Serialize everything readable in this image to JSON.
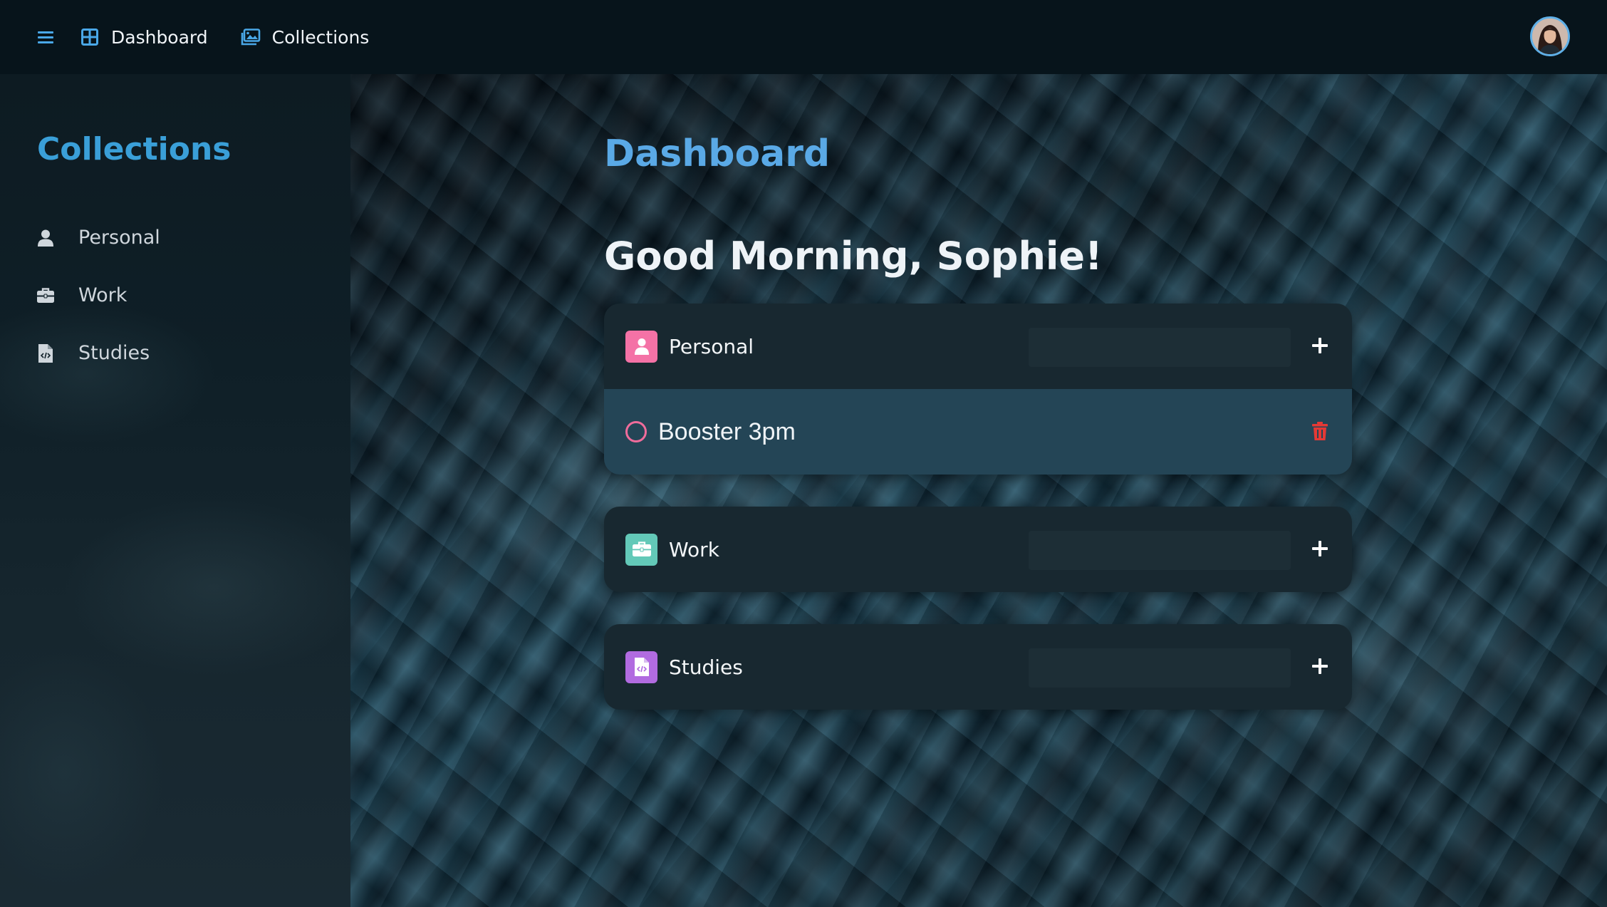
{
  "topbar": {
    "nav": [
      {
        "label": "Dashboard",
        "icon": "dashboard-grid-icon"
      },
      {
        "label": "Collections",
        "icon": "images-icon"
      }
    ],
    "avatar": "user-avatar"
  },
  "sidebar": {
    "title": "Collections",
    "items": [
      {
        "label": "Personal",
        "icon": "user-icon"
      },
      {
        "label": "Work",
        "icon": "briefcase-icon"
      },
      {
        "label": "Studies",
        "icon": "code-file-icon"
      }
    ]
  },
  "main": {
    "title": "Dashboard",
    "greeting": "Good Morning, Sophie!",
    "collections": [
      {
        "name": "Personal",
        "icon": "user-icon",
        "color": "#f472a6",
        "input_value": "",
        "tasks": [
          {
            "text": "Booster 3pm",
            "done": false
          }
        ]
      },
      {
        "name": "Work",
        "icon": "briefcase-icon",
        "color": "#63c9b8",
        "input_value": "",
        "tasks": []
      },
      {
        "name": "Studies",
        "icon": "code-file-icon",
        "color": "#b16be0",
        "input_value": "",
        "tasks": []
      }
    ]
  },
  "colors": {
    "accent": "#3a9fd8",
    "title": "#5aa9e6",
    "delete": "#e53935",
    "checkbox": "#f06c9b"
  }
}
